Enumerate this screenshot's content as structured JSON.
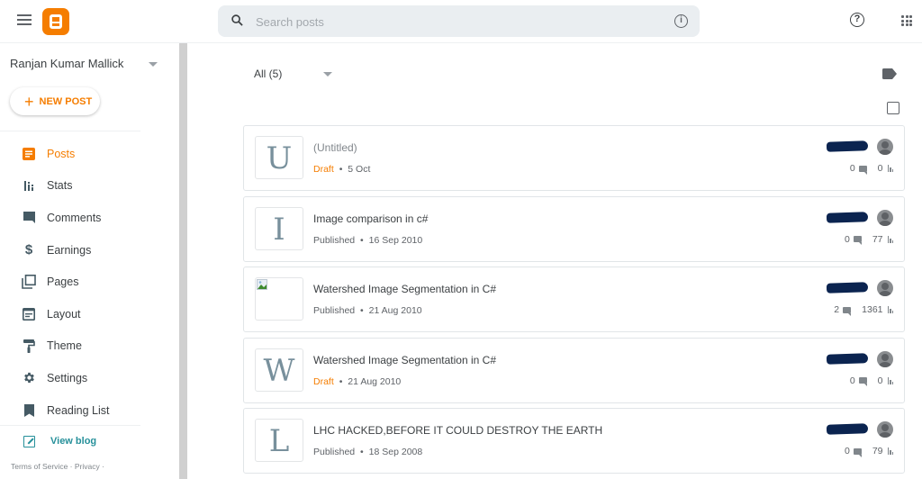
{
  "app": {
    "brand_color": "#f57d00",
    "accent_teal": "#26909a"
  },
  "topbar": {
    "menu_icon": "hamburger-icon",
    "logo_icon": "blogger-logo",
    "search": {
      "placeholder": "Search posts",
      "value": "",
      "icon": "search-icon",
      "info_icon": "info-icon",
      "info_glyph": "i"
    },
    "help_icon": "help-icon",
    "help_glyph": "?",
    "apps_icon": "apps-grid-icon"
  },
  "sidebar": {
    "account_name": "Ranjan Kumar Mallick",
    "new_post": {
      "plus": "+",
      "label": "NEW POST"
    },
    "items": [
      {
        "label": "Posts",
        "icon": "posts-icon",
        "active": true
      },
      {
        "label": "Stats",
        "icon": "stats-icon"
      },
      {
        "label": "Comments",
        "icon": "comments-icon"
      },
      {
        "label": "Earnings",
        "icon": "dollar-icon"
      },
      {
        "label": "Pages",
        "icon": "pages-icon"
      },
      {
        "label": "Layout",
        "icon": "layout-icon"
      },
      {
        "label": "Theme",
        "icon": "paint-roller-icon"
      },
      {
        "label": "Settings",
        "icon": "gear-icon"
      },
      {
        "label": "Reading List",
        "icon": "bookmark-icon"
      }
    ],
    "view_blog": "View blog",
    "footer": {
      "terms": "Terms of Service",
      "sep": "·",
      "privacy": "Privacy",
      "trailing": "·"
    }
  },
  "main": {
    "filter": {
      "selected": "All (5)"
    },
    "label_icon": "label-tag-icon",
    "select_all_icon": "checkbox-icon",
    "posts": [
      {
        "thumb": "U",
        "title": "(Untitled)",
        "status": "Draft",
        "sep": "•",
        "date": "5 Oct",
        "comments": "0",
        "views": "0"
      },
      {
        "thumb": "I",
        "title": "Image comparison in c#",
        "status": "Published",
        "sep": "•",
        "date": "16 Sep 2010",
        "comments": "0",
        "views": "77"
      },
      {
        "thumb": "",
        "thumb_broken": true,
        "title": "Watershed Image Segmentation in C#",
        "status": "Published",
        "sep": "•",
        "date": "21 Aug 2010",
        "comments": "2",
        "views": "1361"
      },
      {
        "thumb": "W",
        "title": "Watershed Image Segmentation in C#",
        "status": "Draft",
        "sep": "•",
        "date": "21 Aug 2010",
        "comments": "0",
        "views": "0"
      },
      {
        "thumb": "L",
        "title": "LHC HACKED,BEFORE IT COULD DESTROY THE EARTH",
        "status": "Published",
        "sep": "•",
        "date": "18 Sep 2008",
        "comments": "0",
        "views": "79"
      }
    ]
  }
}
